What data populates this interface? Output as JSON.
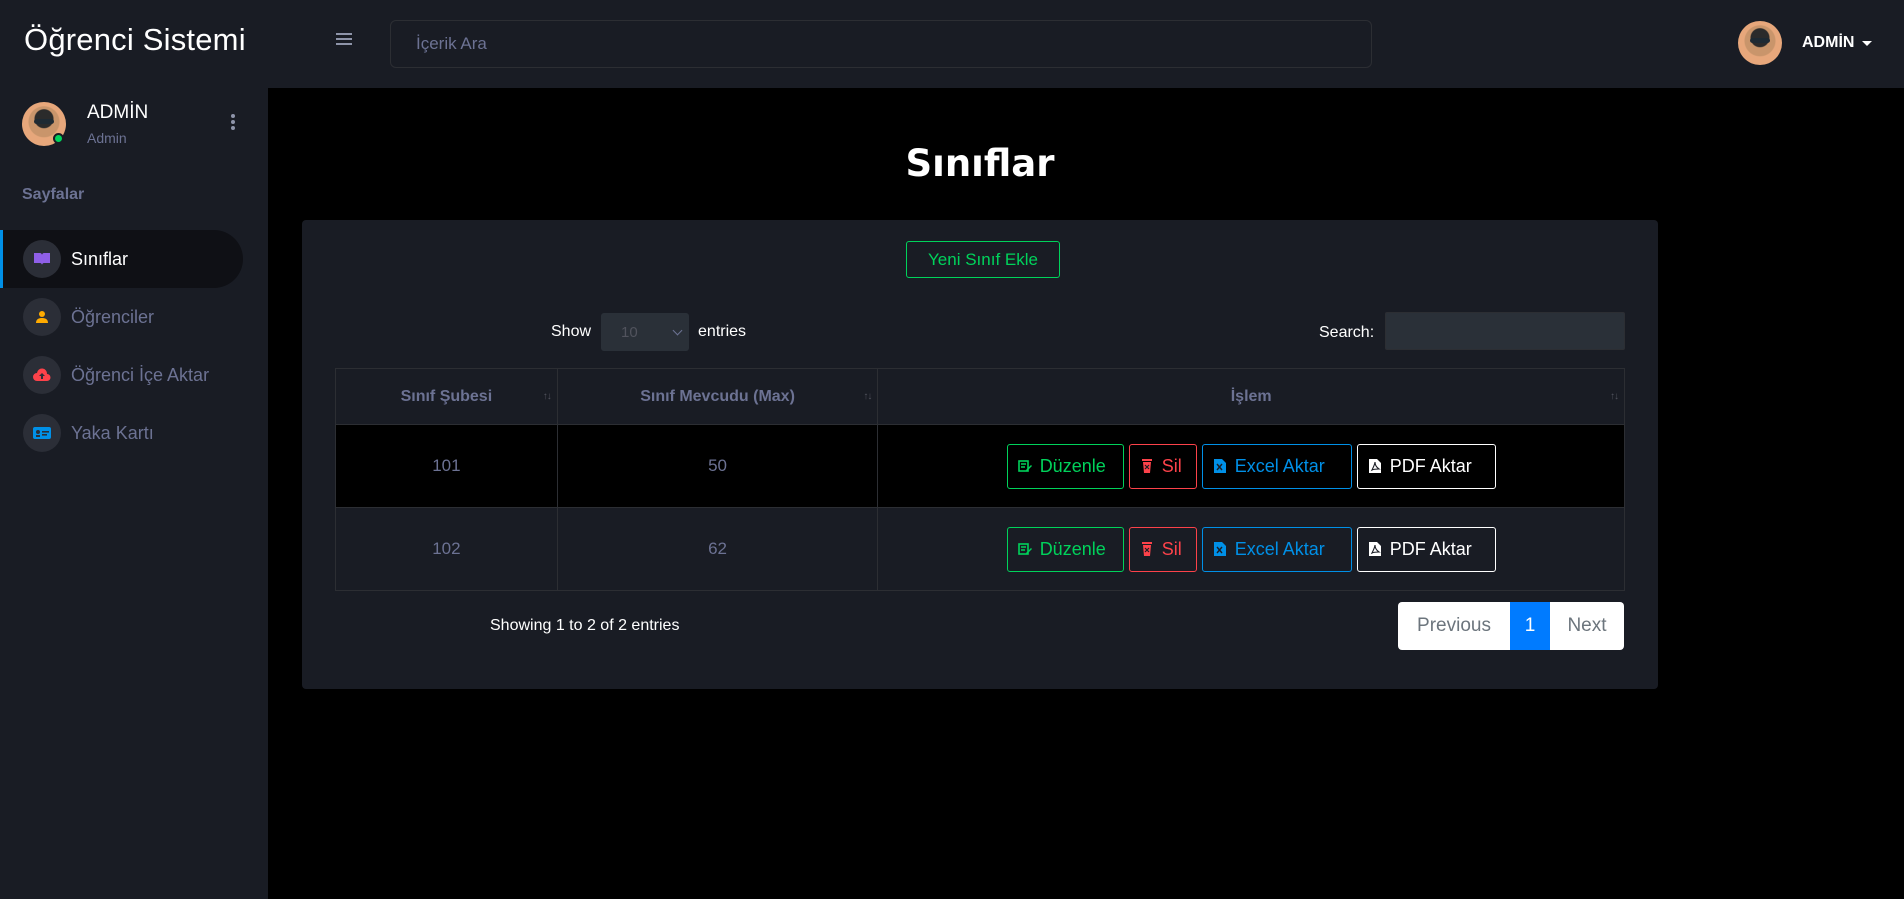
{
  "app": {
    "brand": "Öğrenci Sistemi"
  },
  "topbar": {
    "search_placeholder": "İçerik Ara",
    "user_name": "ADMİN"
  },
  "sidebar": {
    "user_name": "ADMİN",
    "user_role": "Admin",
    "section_title": "Sayfalar",
    "items": [
      {
        "label": "Sınıflar",
        "icon": "book-icon",
        "icon_color": "#8f5fe8",
        "active": true
      },
      {
        "label": "Öğrenciler",
        "icon": "user-icon",
        "icon_color": "#ffab00",
        "active": false
      },
      {
        "label": "Öğrenci İçe Aktar",
        "icon": "cloud-upload-icon",
        "icon_color": "#fc424a",
        "active": false
      },
      {
        "label": "Yaka Kartı",
        "icon": "id-card-icon",
        "icon_color": "#0090e7",
        "active": false
      }
    ]
  },
  "main": {
    "title": "Sınıflar",
    "add_button": "Yeni Sınıf Ekle",
    "length": {
      "show": "Show",
      "value": "10",
      "entries": "entries"
    },
    "search_label": "Search:",
    "columns": [
      "Sınıf Şubesi",
      "Sınıf Mevcudu (Max)",
      "İşlem"
    ],
    "rows": [
      {
        "sube": "101",
        "mevcut": "50"
      },
      {
        "sube": "102",
        "mevcut": "62"
      }
    ],
    "actions": {
      "edit": "Düzenle",
      "delete": "Sil",
      "excel": "Excel Aktar",
      "pdf": "PDF Aktar"
    },
    "info": "Showing 1 to 2 of 2 entries",
    "pagination": {
      "previous": "Previous",
      "current": "1",
      "next": "Next"
    }
  },
  "colors": {
    "accent_blue": "#0090e7",
    "success": "#00d25b",
    "danger": "#fc424a",
    "page_blue": "#007bff"
  }
}
